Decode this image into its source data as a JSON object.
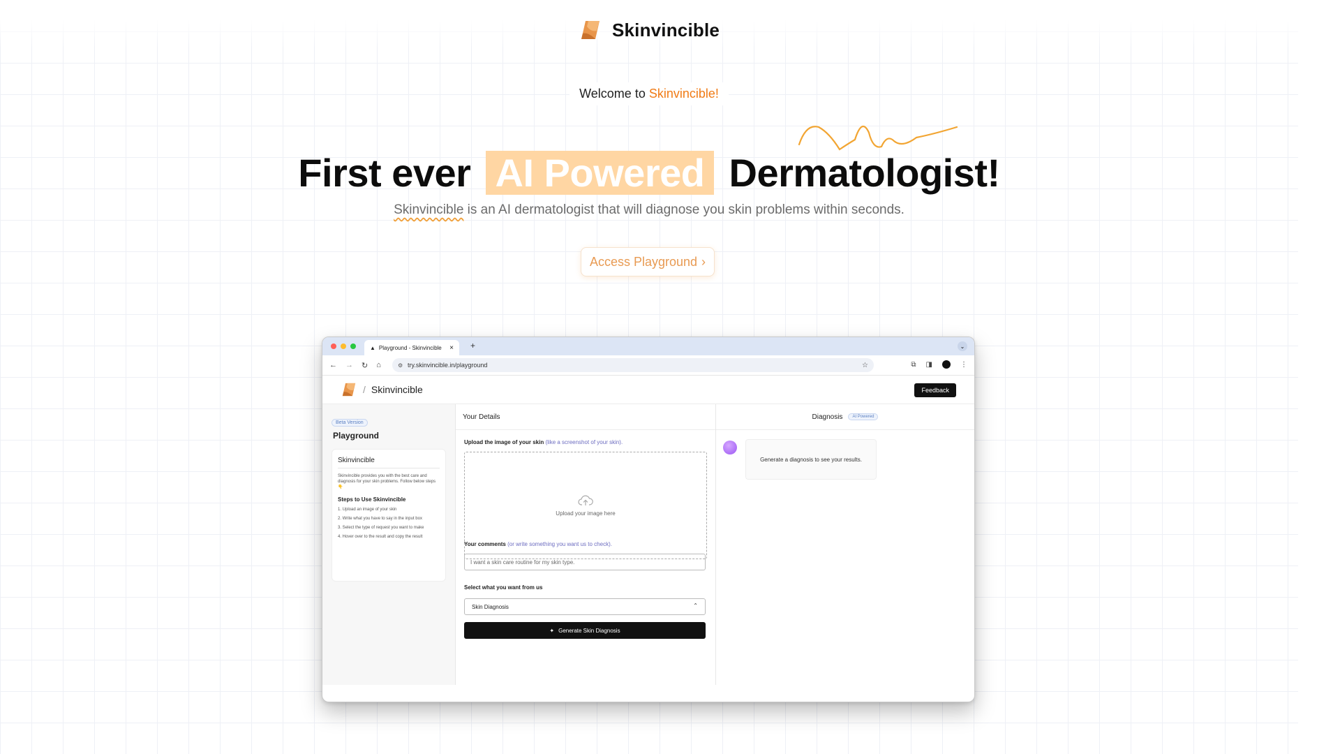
{
  "header": {
    "brand": "Skinvincible"
  },
  "welcome": {
    "prefix": "Welcome to ",
    "accent": "Skinvincible!"
  },
  "hero": {
    "part1": "First ever",
    "highlight": "AI Powered",
    "part2": "Dermatologist!"
  },
  "subtitle": {
    "brand": "Skinvincible",
    "rest": " is an AI dermatologist that will diagnose you skin problems within seconds."
  },
  "cta": {
    "label": "Access Playground",
    "arrow": "›"
  },
  "browser": {
    "tab_title": "Playground - Skinvincible",
    "tab_close": "×",
    "new_tab": "+",
    "url": "try.skinvincible.in/playground",
    "app": {
      "title": "Skinvincible",
      "feedback": "Feedback",
      "sidebar": {
        "beta": "Beta Version",
        "playground": "Playground",
        "card_title": "Skinvincible",
        "card_desc": "Skinvincible provides you with the best care and diagnosis for your skin problems. Follow below steps 👇",
        "steps_title": "Steps to Use Skinvincible",
        "steps": [
          "1. Upload an image of your skin",
          "2. Write what you have to say in the input box",
          "3. Select the type of request you want to make",
          "4. Hover over to the result and copy the result"
        ]
      },
      "details": {
        "header": "Your Details",
        "upload_label": "Upload the image of your skin",
        "upload_hint": "(like a screenshot of your skin).",
        "upload_text": "Upload your image here",
        "comments_label": "Your comments",
        "comments_hint": "(or write something you want us to check).",
        "comments_placeholder": "I want a skin care routine for my skin type.",
        "select_label": "Select what you want from us",
        "select_value": "Skin Diagnosis",
        "generate": "Generate Skin Diagnosis"
      },
      "diagnosis": {
        "header": "Diagnosis",
        "badge": "AI Powered",
        "message": "Generate a diagnosis to see your results."
      }
    }
  },
  "colors": {
    "accent": "#f07b16",
    "highlight_bg": "#ffd6a3",
    "cta_text": "#e89a52"
  }
}
